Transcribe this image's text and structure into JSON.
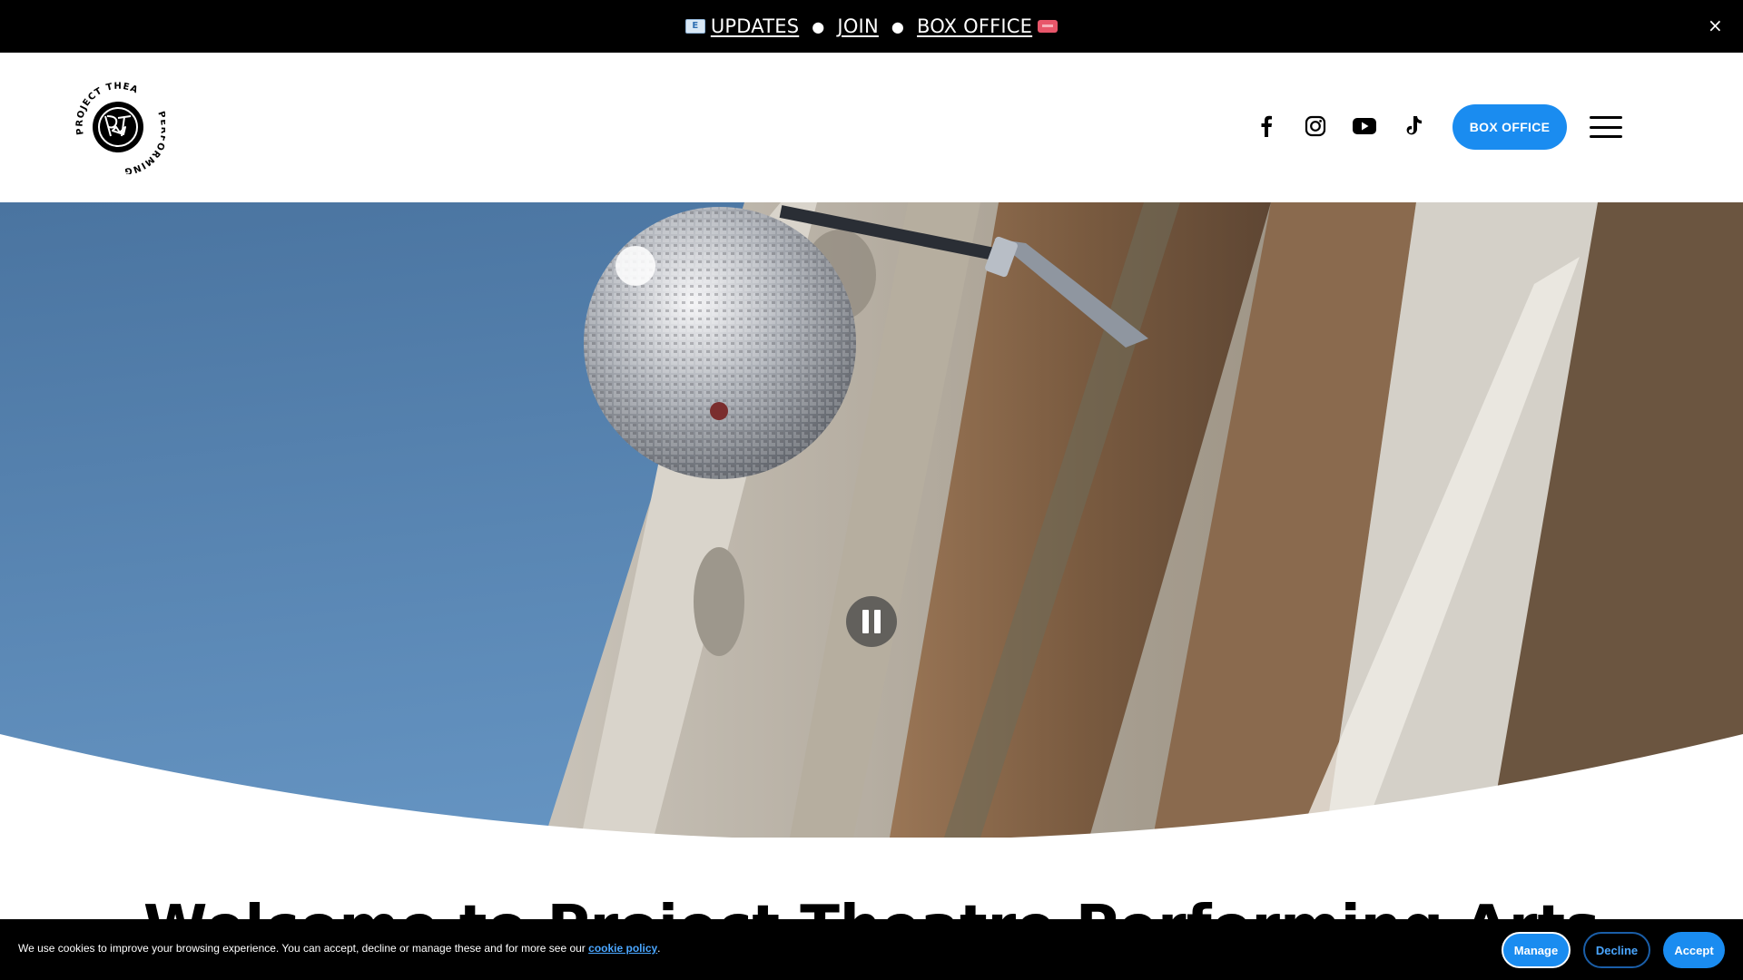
{
  "announcement": {
    "updates_label": "UPDATES",
    "separator": "●",
    "join_label": "JOIN",
    "box_office_label": "BOX OFFICE",
    "close_icon": "×"
  },
  "header": {
    "logo_top_text": "PROJECT THEATRE",
    "logo_bottom_text": "PERFORMING ARTS",
    "logo_monogram": "PT",
    "socials": [
      "facebook-icon",
      "instagram-icon",
      "youtube-icon",
      "tiktok-icon"
    ],
    "box_office_label": "BOX OFFICE",
    "menu_icon": "hamburger-icon"
  },
  "hero": {
    "media": "video of disco ball on theatre facade",
    "control_icon": "pause-icon"
  },
  "intro": {
    "title": "Welcome to Project Theatre Performing Arts"
  },
  "cookie_banner": {
    "text": "We use cookies to improve your browsing experience. You can accept, decline or manage these and for more see our ",
    "link_label": "cookie policy",
    "trailing": ".",
    "manage_label": "Manage",
    "decline_label": "Decline",
    "accept_label": "Accept"
  },
  "colors": {
    "accent": "#1a8cf0",
    "announcement_bg": "#000000",
    "sky": "#5b89b8"
  }
}
